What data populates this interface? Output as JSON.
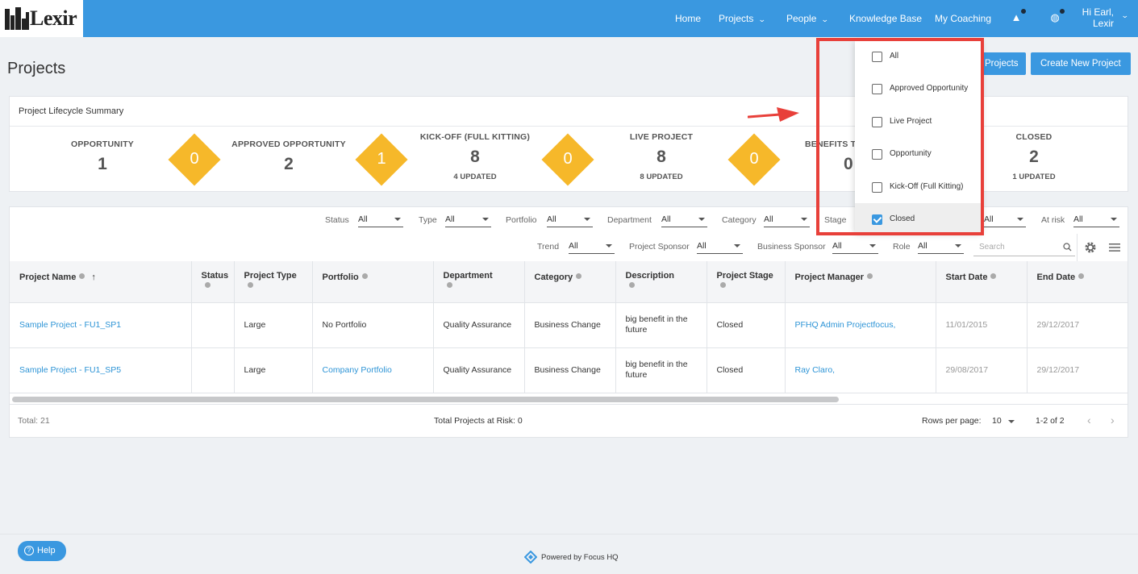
{
  "brand": {
    "name": "Lexir"
  },
  "nav": {
    "home": "Home",
    "projects": "Projects",
    "people": "People",
    "knowledge_base": "Knowledge Base",
    "my_coaching": "My Coaching",
    "user_greeting": "Hi Earl,",
    "user_org": "Lexir"
  },
  "page": {
    "title": "Projects",
    "btn_projects": "Projects",
    "btn_create": "Create New Project"
  },
  "lifecycle": {
    "title": "Project Lifecycle Summary",
    "stages": [
      {
        "label": "Opportunity",
        "count": "1",
        "updated": ""
      },
      {
        "label": "Approved Opportunity",
        "count": "2",
        "updated": ""
      },
      {
        "label": "Kick-off (Full Kitting)",
        "count": "8",
        "updated": "4 UPDATED"
      },
      {
        "label": "Live Project",
        "count": "8",
        "updated": "8 UPDATED"
      },
      {
        "label": "Benefits Tr",
        "count": "0",
        "updated": ""
      },
      {
        "label": "Closed",
        "count": "2",
        "updated": "1 UPDATED"
      }
    ],
    "transitions": [
      "0",
      "1",
      "0",
      "0"
    ]
  },
  "filters": {
    "row1": [
      {
        "label": "Status",
        "value": "All"
      },
      {
        "label": "Type",
        "value": "All"
      },
      {
        "label": "Portfolio",
        "value": "All"
      },
      {
        "label": "Department",
        "value": "All"
      },
      {
        "label": "Category",
        "value": "All"
      },
      {
        "label": "Stage",
        "value": ""
      },
      {
        "label": "",
        "value": "All"
      },
      {
        "label": "At risk",
        "value": "All"
      }
    ],
    "row2": [
      {
        "label": "Trend",
        "value": "All"
      },
      {
        "label": "Project Sponsor",
        "value": "All"
      },
      {
        "label": "Business Sponsor",
        "value": "All"
      },
      {
        "label": "Role",
        "value": "All"
      }
    ],
    "search_placeholder": "Search"
  },
  "stage_dropdown": {
    "options": [
      {
        "label": "All",
        "checked": false
      },
      {
        "label": "Approved Opportunity",
        "checked": false
      },
      {
        "label": "Live Project",
        "checked": false
      },
      {
        "label": "Opportunity",
        "checked": false
      },
      {
        "label": "Kick-Off (Full Kitting)",
        "checked": false
      },
      {
        "label": "Closed",
        "checked": true
      }
    ]
  },
  "table": {
    "columns": [
      "Project Name",
      "Status",
      "Project Type",
      "Portfolio",
      "Department",
      "Category",
      "Description",
      "Project Stage",
      "Project Manager",
      "Start Date",
      "End Date"
    ],
    "rows": [
      {
        "name": "Sample Project - FU1_SP1",
        "status": "",
        "type": "Large",
        "portfolio": "No Portfolio",
        "department": "Quality Assurance",
        "category": "Business Change",
        "description": "big benefit in the future",
        "stage": "Closed",
        "manager": "PFHQ Admin Projectfocus,",
        "start": "11/01/2015",
        "end": "29/12/2017"
      },
      {
        "name": "Sample Project - FU1_SP5",
        "status": "",
        "type": "Large",
        "portfolio": "Company Portfolio",
        "department": "Quality Assurance",
        "category": "Business Change",
        "description": "big benefit in the future",
        "stage": "Closed",
        "manager": "Ray Claro,",
        "start": "29/08/2017",
        "end": "29/12/2017"
      }
    ]
  },
  "footer": {
    "total": "Total: 21",
    "at_risk": "Total Projects at Risk: 0",
    "rows_per_page_label": "Rows per page:",
    "rows_per_page": "10",
    "range": "1-2 of 2"
  },
  "help": "Help",
  "powered_by": "Powered by Focus HQ",
  "colors": {
    "primary": "#3a98e0",
    "diamond": "#f6b82a",
    "highlight": "#e8403a"
  }
}
